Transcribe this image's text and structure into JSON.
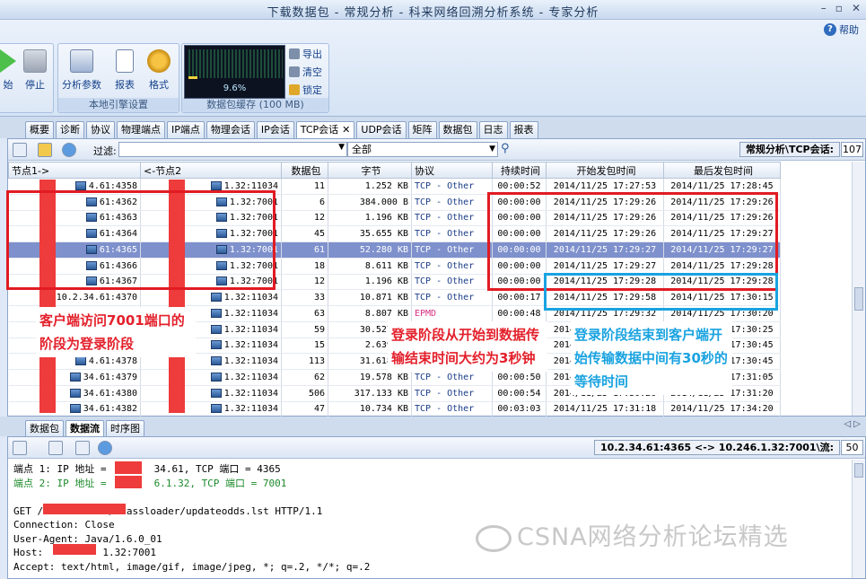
{
  "window": {
    "title": "下载数据包 - 常规分析 - 科来网络回溯分析系统 - 专家分析",
    "help_label": "帮助"
  },
  "ribbon": {
    "start_label": "始",
    "stop_label": "停止",
    "local_engine": {
      "label": "本地引擎设置",
      "analysis_params": "分析参数",
      "report": "报表",
      "format": "格式"
    },
    "buffer": {
      "label": "数据包缓存 (100 MB)",
      "percent": "9.6%",
      "fill_fraction": 0.096,
      "export": "导出",
      "clear": "清空",
      "lock": "锁定"
    }
  },
  "tabs": [
    "概要",
    "诊断",
    "协议",
    "物理端点",
    "IP端点",
    "物理会话",
    "IP会话",
    "TCP会话",
    "UDP会话",
    "矩阵",
    "数据包",
    "日志",
    "报表"
  ],
  "active_tab": "TCP会话",
  "filter": {
    "label": "过滤:",
    "value": "",
    "scope": "全部"
  },
  "breadcrumb": "常规分析\\TCP会话:",
  "session_count": "107",
  "table": {
    "headers": [
      "节点1->",
      "<-节点2",
      "数据包",
      "字节",
      "协议",
      "持续时间",
      "开始发包时间",
      "最后发包时间"
    ],
    "rows": [
      [
        "4.61:4358",
        "1.32:11034",
        "11",
        "1.252 KB",
        "TCP - Other",
        "00:00:52",
        "2014/11/25 17:27:53",
        "2014/11/25 17:28:45"
      ],
      [
        "61:4362",
        "1.32:7001",
        "6",
        "384.000 B",
        "TCP - Other",
        "00:00:00",
        "2014/11/25 17:29:26",
        "2014/11/25 17:29:26"
      ],
      [
        "61:4363",
        "1.32:7001",
        "12",
        "1.196 KB",
        "TCP - Other",
        "00:00:00",
        "2014/11/25 17:29:26",
        "2014/11/25 17:29:26"
      ],
      [
        "61:4364",
        "1.32:7001",
        "45",
        "35.655 KB",
        "TCP - Other",
        "00:00:00",
        "2014/11/25 17:29:26",
        "2014/11/25 17:29:27"
      ],
      [
        "61:4365",
        "1.32:7001",
        "61",
        "52.280 KB",
        "TCP - Other",
        "00:00:00",
        "2014/11/25 17:29:27",
        "2014/11/25 17:29:27"
      ],
      [
        "61:4366",
        "1.32:7001",
        "18",
        "8.611 KB",
        "TCP - Other",
        "00:00:00",
        "2014/11/25 17:29:27",
        "2014/11/25 17:29:28"
      ],
      [
        "61:4367",
        "1.32:7001",
        "12",
        "1.196 KB",
        "TCP - Other",
        "00:00:00",
        "2014/11/25 17:29:28",
        "2014/11/25 17:29:28"
      ],
      [
        "10.2.34.61:4370",
        "1.32:11034",
        "33",
        "10.871 KB",
        "TCP - Other",
        "00:00:17",
        "2014/11/25 17:29:58",
        "2014/11/25 17:30:15"
      ],
      [
        "4.61:4374",
        "1.32:11034",
        "63",
        "8.807 KB",
        "EPMD",
        "00:00:48",
        "2014/11/25 17:29:32",
        "2014/11/25 17:30:20"
      ],
      [
        "4.61:4375",
        "1.32:11034",
        "59",
        "30.527 KB",
        "TCP - Other",
        "00:00:42",
        "2014/11/25 17:29:43",
        "2014/11/25 17:30:25"
      ],
      [
        "4.61:4376",
        "1.32:11034",
        "15",
        "2.639 KB",
        "TCP - Other",
        "00:00:42",
        "2014/11/25 17:30:03",
        "2014/11/25 17:30:45"
      ],
      [
        "4.61:4378",
        "1.32:11034",
        "113",
        "31.618 KB",
        "TCP - Other",
        "00:00:48",
        "2014/11/25 17:29:57",
        "2014/11/25 17:30:45"
      ],
      [
        "34.61:4379",
        "1.32:11034",
        "62",
        "19.578 KB",
        "TCP - Other",
        "00:00:50",
        "2014/11/25 17:30:15",
        "2014/11/25 17:31:05"
      ],
      [
        "34.61:4380",
        "1.32:11034",
        "506",
        "317.133 KB",
        "TCP - Other",
        "00:00:54",
        "2014/11/25 17:30:26",
        "2014/11/25 17:31:20"
      ],
      [
        "34.61:4382",
        "1.32:11034",
        "47",
        "10.734 KB",
        "TCP - Other",
        "00:03:03",
        "2014/11/25 17:31:18",
        "2014/11/25 17:34:20"
      ]
    ],
    "selected_row": 4
  },
  "annotations": {
    "client_login": "客户端访问7001端口的阶段为登录阶段",
    "login_duration": "登录阶段从开始到数据传输结束时间大约为3秒钟",
    "wait_time": "登录阶段结束到客户端开始传输数据中间有30秒的等待时间"
  },
  "lower": {
    "tabs": [
      "数据包",
      "数据流",
      "时序图"
    ],
    "active_tab": "数据流",
    "stream_label": "10.2.34.61:4365 <-> 10.246.1.32:7001\\流:",
    "stream_count": "50",
    "lines": [
      "端点 1: IP 地址 =        34.61, TCP 端口 = 4365",
      "端点 2: IP 地址 =        6.1.32, TCP 端口 = 7001",
      "",
      "GET /           /classloader/updateodds.lst HTTP/1.1",
      "Connection: Close",
      "User-Agent: Java/1.6.0_01",
      "Host:          1.32:7001",
      "Accept: text/html, image/gif, image/jpeg, *; q=.2, */*; q=.2"
    ]
  },
  "watermark": "CSNA网络分析论坛精选"
}
